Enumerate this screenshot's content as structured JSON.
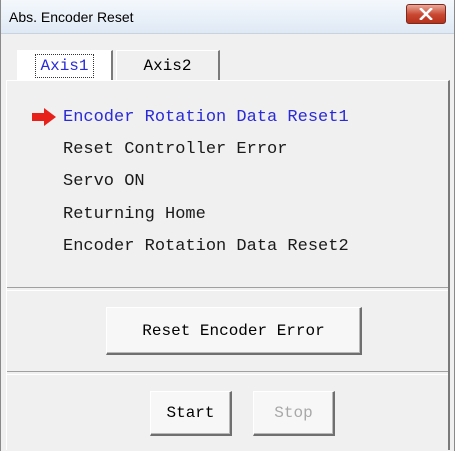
{
  "window": {
    "title": "Abs. Encoder Reset"
  },
  "tabs": [
    {
      "label": "Axis1",
      "active": true
    },
    {
      "label": "Axis2",
      "active": false
    }
  ],
  "steps": [
    {
      "label": "Encoder Rotation Data Reset1",
      "current": true
    },
    {
      "label": "Reset Controller Error",
      "current": false
    },
    {
      "label": "Servo ON",
      "current": false
    },
    {
      "label": "Returning Home",
      "current": false
    },
    {
      "label": "Encoder Rotation Data Reset2",
      "current": false
    }
  ],
  "buttons": {
    "reset_encoder_error": "Reset Encoder Error",
    "start": "Start",
    "stop": "Stop"
  },
  "colors": {
    "current_step": "#2a2ad8",
    "arrow": "#e8201a",
    "close_button": "#c8452f"
  },
  "icons": {
    "current_step_indicator": "right-arrow-icon",
    "close": "close-icon"
  }
}
